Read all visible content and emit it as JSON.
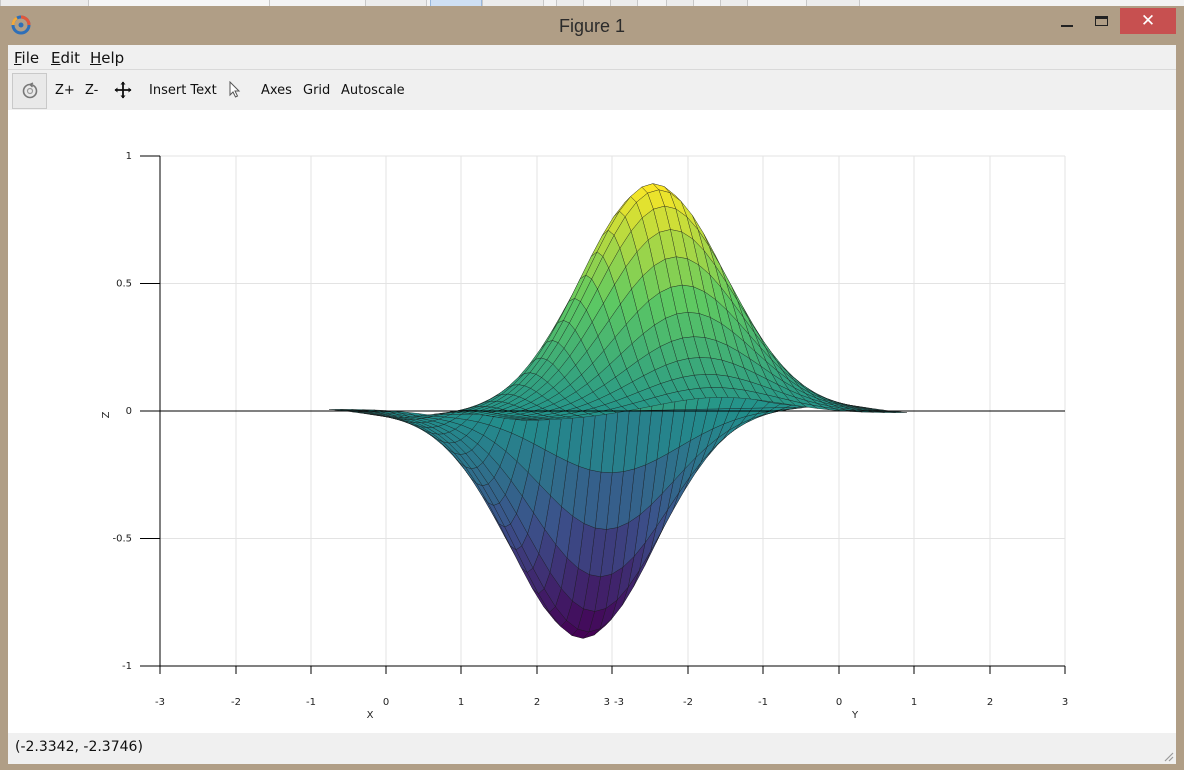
{
  "window": {
    "title": "Figure 1"
  },
  "menu": {
    "file": {
      "hotkey": "F",
      "rest": "ile"
    },
    "edit": {
      "hotkey": "E",
      "rest": "dit"
    },
    "help": {
      "hotkey": "H",
      "rest": "elp"
    }
  },
  "toolbar": {
    "zoom_in": "Z+",
    "zoom_out": "Z-",
    "insert_text": "Insert Text",
    "axes": "Axes",
    "grid": "Grid",
    "autoscale": "Autoscale"
  },
  "icons": {
    "app": "app-logo-icon",
    "rotate": "rotate-icon",
    "pan": "pan-move-icon",
    "pointer": "pointer-arrow-icon",
    "minimize": "minimize-icon",
    "maximize": "maximize-icon",
    "close": "close-icon"
  },
  "colors": {
    "frame": "#b09e86",
    "close_button": "#c75050",
    "surface_top": "#fde725",
    "surface_mid": "#21918c",
    "surface_low": "#440154"
  },
  "status": {
    "coordinates": "(-2.3342, -2.3746)"
  },
  "chart_data": {
    "type": "surface",
    "zlabel": "Z",
    "xlabel": "X",
    "ylabel": "Y",
    "z_ticks": [
      "1",
      "0.5",
      "0",
      "-0.5",
      "-1"
    ],
    "x_ticks": [
      "-3",
      "-2",
      "-1",
      "0",
      "1",
      "2",
      "3"
    ],
    "y_ticks": [
      "-3",
      "-2",
      "-1",
      "0",
      "1",
      "2",
      "3"
    ],
    "zlim": [
      -1,
      1
    ],
    "xlim": [
      -3,
      3
    ],
    "ylim": [
      -3,
      3
    ],
    "grid": true,
    "z_max": 0.9,
    "z_min": -0.9
  }
}
